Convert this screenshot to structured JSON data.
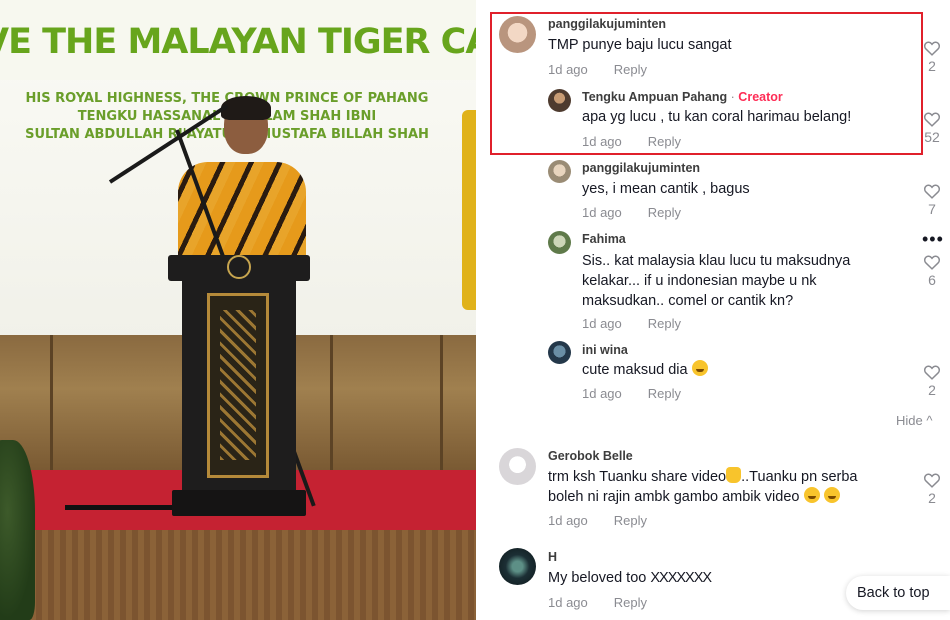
{
  "video": {
    "banner_title": "VE THE MALAYAN TIGER CAMPAIGN",
    "banner_lines": [
      "HIS ROYAL HIGHNESS, THE CROWN PRINCE OF PAHANG",
      "TENGKU HASSANAL IBRA  LAM SHAH IBNI",
      "SULTAN ABDULLAH RI'AYATUDD   MUSTAFA BILLAH SHAH"
    ]
  },
  "comments": [
    {
      "username": "panggilakujuminten",
      "text": "TMP punye baju lucu sangat",
      "time": "1d ago",
      "reply_label": "Reply",
      "likes": "2"
    },
    {
      "username": "Tengku Ampuan Pahang",
      "badge": "Creator",
      "text": "apa yg lucu , tu kan coral harimau belang!",
      "time": "1d ago",
      "reply_label": "Reply",
      "likes": "52"
    },
    {
      "username": "panggilakujuminten",
      "text": "yes, i mean cantik , bagus",
      "time": "1d ago",
      "reply_label": "Reply",
      "likes": "7"
    },
    {
      "username": "Fahima",
      "text_lines": [
        "Sis.. kat malaysia klau lucu tu maksudnya",
        "kelakar... if u indonesian maybe u nk",
        "maksudkan.. comel or cantik kn?"
      ],
      "time": "1d ago",
      "reply_label": "Reply",
      "likes": "6"
    },
    {
      "username": "ini wina",
      "text": "cute maksud dia",
      "time": "1d ago",
      "reply_label": "Reply",
      "likes": "2"
    },
    {
      "username": "Gerobok Belle",
      "text_lines": [
        "trm ksh Tuanku share video",
        "..Tuanku pn serba",
        "boleh ni rajin ambk gambo ambik video"
      ],
      "time": "1d ago",
      "reply_label": "Reply",
      "likes": "2"
    },
    {
      "username": "H",
      "text": "My beloved too",
      "text_suffix": "XXXXXXX",
      "time": "1d ago",
      "reply_label": "Reply"
    }
  ],
  "more_label": "•••",
  "hide_label": "Hide",
  "hide_chevron": "^",
  "back_to_top": "Back to top"
}
